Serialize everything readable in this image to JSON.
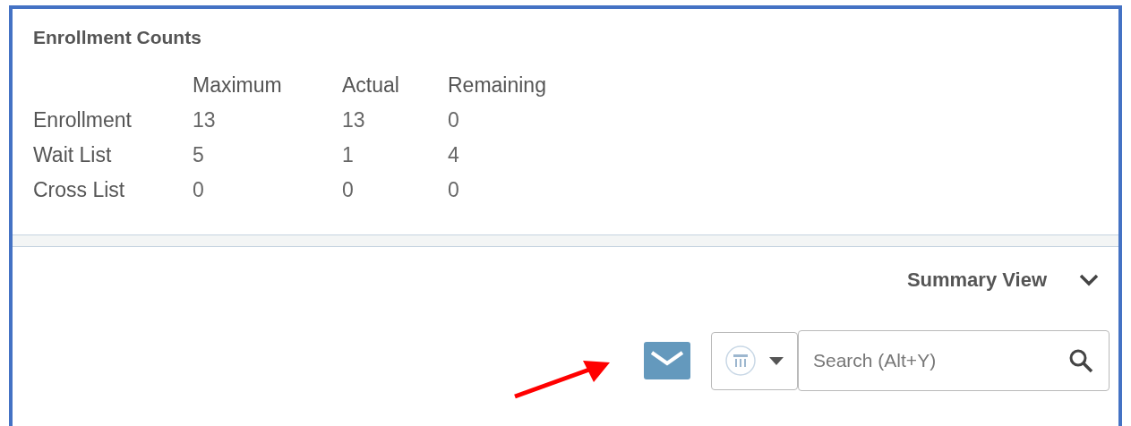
{
  "enrollment_counts": {
    "title": "Enrollment Counts",
    "columns": [
      "Maximum",
      "Actual",
      "Remaining"
    ],
    "rows": [
      {
        "label": "Enrollment",
        "values": [
          "13",
          "13",
          "0"
        ]
      },
      {
        "label": "Wait List",
        "values": [
          "5",
          "1",
          "4"
        ]
      },
      {
        "label": "Cross List",
        "values": [
          "0",
          "0",
          "0"
        ]
      }
    ]
  },
  "summary_view": {
    "label": "Summary View"
  },
  "toolbar": {
    "search": {
      "placeholder": "Search (Alt+Y)"
    }
  }
}
